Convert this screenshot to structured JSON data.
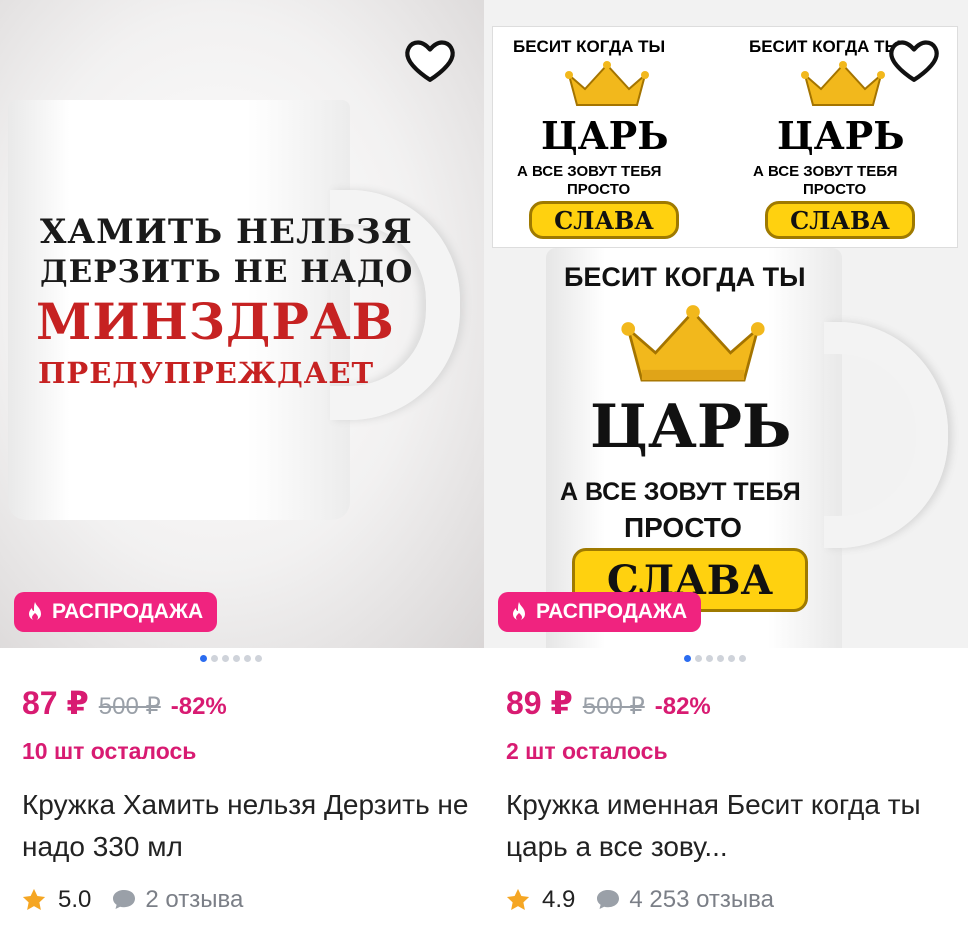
{
  "products": [
    {
      "badge": "РАСПРОДАЖА",
      "price": "87 ₽",
      "old_price": "500 ₽",
      "discount": "-82%",
      "stock": "10 шт осталось",
      "title": "Кружка Хамить нельзя Дерзить не надо 330 мл",
      "rating": "5.0",
      "reviews": "2 отзыва",
      "mug_text": [
        "ХАМИТЬ НЕЛЬЗЯ",
        "ДЕРЗИТЬ НЕ НАДО",
        "МИНЗДРАВ",
        "ПРЕДУПРЕЖДАЕТ"
      ]
    },
    {
      "badge": "РАСПРОДАЖА",
      "price": "89 ₽",
      "old_price": "500 ₽",
      "discount": "-82%",
      "stock": "2 шт осталось",
      "title": "Кружка именная Бесит когда ты царь а все зову...",
      "rating": "4.9",
      "reviews": "4 253 отзыва",
      "mug_text": [
        "БЕСИТ КОГДА ТЫ",
        "ЦАРЬ",
        "А ВСЕ ЗОВУТ ТЕБЯ",
        "ПРОСТО",
        "СЛАВА"
      ]
    }
  ],
  "icons": {
    "favorite": "heart-outline-icon",
    "sale": "fire-icon",
    "rating": "star-icon",
    "reviews": "chat-bubble-icon"
  },
  "colors": {
    "accent": "#f0237f",
    "price": "#d81b72",
    "star": "#f5a623",
    "dot_active": "#2b6cf0"
  }
}
